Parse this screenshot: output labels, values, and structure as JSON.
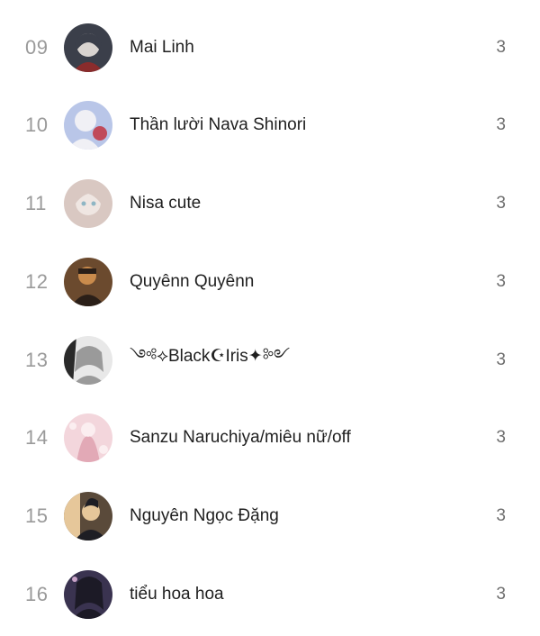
{
  "leaderboard": {
    "rows": [
      {
        "rank": "09",
        "name": "Mai Linh",
        "count": "3",
        "avatar_colors": [
          "#3b3f4a",
          "#d9d4d0",
          "#8a2c2c"
        ]
      },
      {
        "rank": "10",
        "name": "Thần lười Nava Shinori",
        "count": "3",
        "avatar_colors": [
          "#b9c6e8",
          "#f0f0f5",
          "#c04a5a"
        ]
      },
      {
        "rank": "11",
        "name": "Nisa cute",
        "count": "3",
        "avatar_colors": [
          "#d9c8c2",
          "#efe6e2",
          "#8fb6c4"
        ]
      },
      {
        "rank": "12",
        "name": "Quyênn Quyênn",
        "count": "3",
        "avatar_colors": [
          "#6b4a2e",
          "#c98b4c",
          "#2a1f18"
        ]
      },
      {
        "rank": "13",
        "name": "༺⟡Black☪Iris✦༻",
        "count": "3",
        "avatar_colors": [
          "#2a2a2a",
          "#e8e8e8",
          "#9a9a9a"
        ]
      },
      {
        "rank": "14",
        "name": "Sanzu Naruchiya/miêu nữ/off",
        "count": "3",
        "avatar_colors": [
          "#f3d6dc",
          "#fbeef0",
          "#e2a9b6"
        ]
      },
      {
        "rank": "15",
        "name": "Nguyên Ngọc Đặng",
        "count": "3",
        "avatar_colors": [
          "#5a4a3a",
          "#e6c79a",
          "#1e1e24"
        ]
      },
      {
        "rank": "16",
        "name": "tiểu hoa hoa",
        "count": "3",
        "avatar_colors": [
          "#3a3350",
          "#c9a3c8",
          "#1c1a26"
        ]
      }
    ]
  }
}
